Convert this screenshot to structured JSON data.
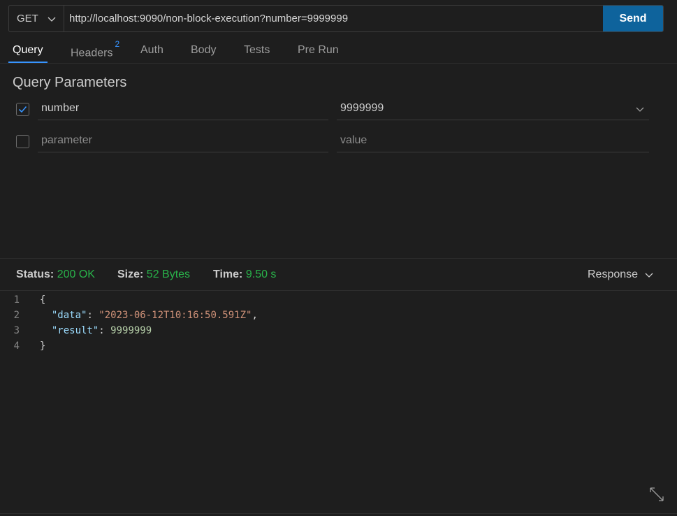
{
  "request": {
    "method": "GET",
    "url": "http://localhost:9090/non-block-execution?number=9999999",
    "send_label": "Send"
  },
  "tabs": [
    {
      "label": "Query",
      "active": true
    },
    {
      "label": "Headers",
      "badge": "2"
    },
    {
      "label": "Auth"
    },
    {
      "label": "Body"
    },
    {
      "label": "Tests"
    },
    {
      "label": "Pre Run"
    }
  ],
  "query": {
    "title": "Query Parameters",
    "rows": [
      {
        "checked": true,
        "key": "number",
        "value": "9999999"
      },
      {
        "checked": false,
        "key_placeholder": "parameter",
        "value_placeholder": "value"
      }
    ]
  },
  "status": {
    "status_label": "Status:",
    "status_value": "200 OK",
    "size_label": "Size:",
    "size_value": "52 Bytes",
    "time_label": "Time:",
    "time_value": "9.50 s",
    "response_select": "Response"
  },
  "response_body": {
    "line_numbers": [
      "1",
      "2",
      "3",
      "4"
    ],
    "open_brace": "{",
    "close_brace": "}",
    "data_key": "\"data\"",
    "data_value": "\"2023-06-12T10:16:50.591Z\"",
    "result_key": "\"result\"",
    "result_value": "9999999"
  },
  "colors": {
    "accent": "#0e639c",
    "tab_underline": "#3794ff",
    "status_ok": "#29b34a"
  },
  "icons": [
    "chevron-down-icon",
    "checkmark-icon",
    "expand-icon"
  ]
}
